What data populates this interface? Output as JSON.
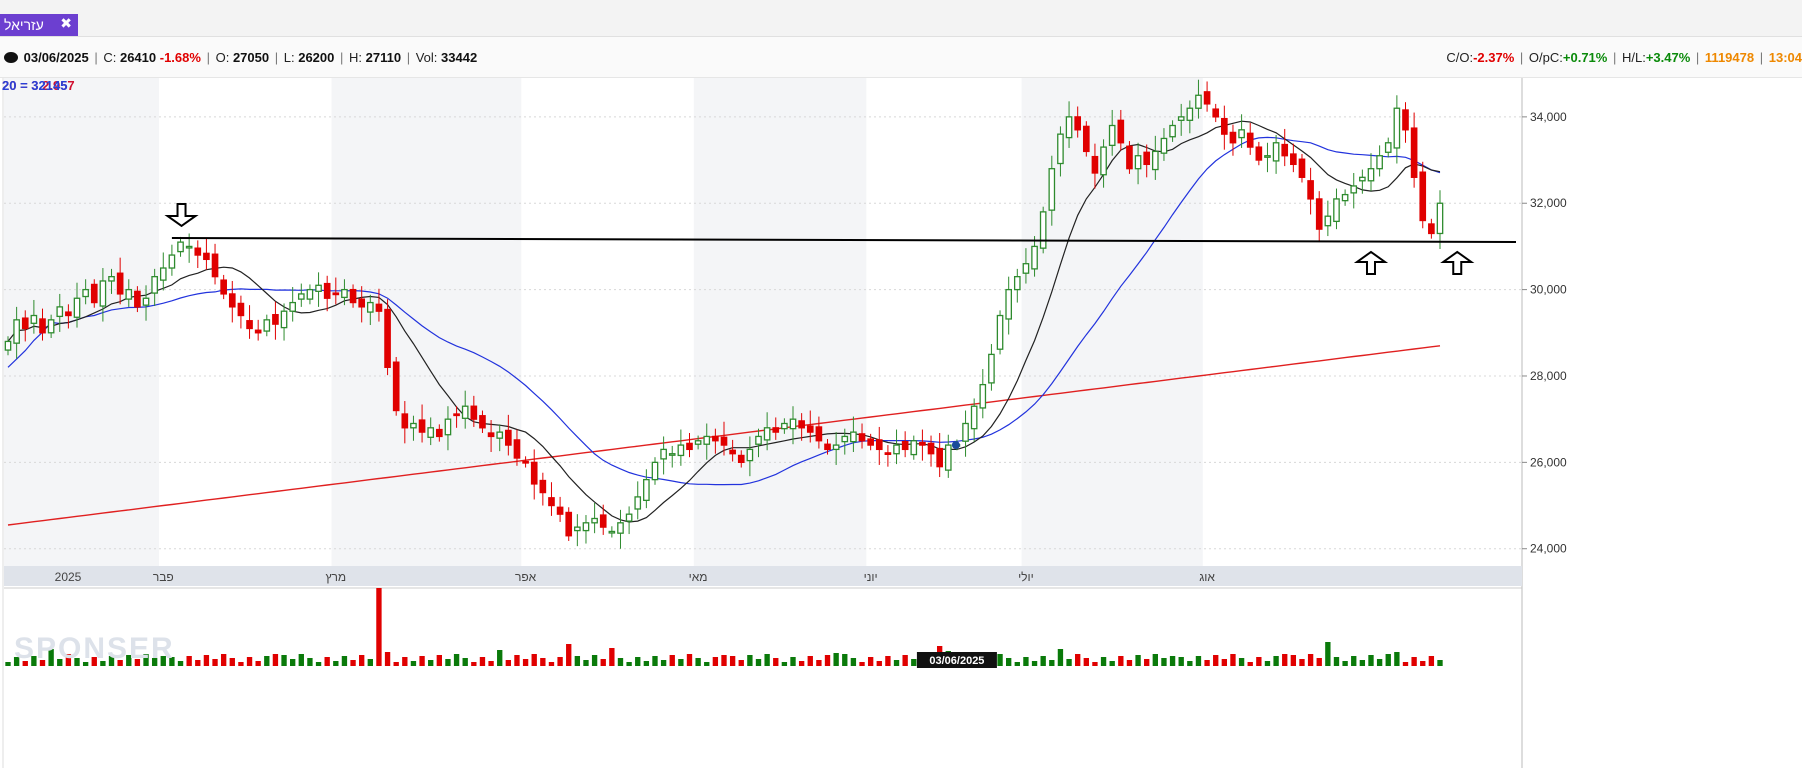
{
  "tab": {
    "label": "עזריאל",
    "close": "✖"
  },
  "infobar": {
    "date": "03/06/2025",
    "close_label": "C:",
    "close_value": "26410",
    "change_pct": "-1.68%",
    "open_label": "O:",
    "open_value": "27050",
    "low_label": "L:",
    "low_value": "26200",
    "high_label": "H:",
    "high_value": "27110",
    "vol_label": "Vol:",
    "vol_value": "33442",
    "co_label": "C/O:",
    "co_value": "-2.37%",
    "opc_label": "O/pC:",
    "opc_value": "+0.71%",
    "hl_label": "H/L:",
    "hl_value": "+3.47%",
    "count": "1119478",
    "time": "13:04"
  },
  "overlay": {
    "red_text": "20 = 3 2.957",
    "blue_text": "20 = 32145"
  },
  "watermark": "SPONSER",
  "colors": {
    "up": "#2e8b2e",
    "down": "#e00000",
    "ma_short": "#222222",
    "ma_mid": "#2233dd",
    "ma_long": "#e02020",
    "accent": "#6c3fd0"
  },
  "chart_data": {
    "type": "candlestick",
    "ylim": [
      23600,
      34900
    ],
    "y_ticks": [
      "34,000",
      "32,000",
      "30,000",
      "28,000",
      "26,000",
      "24,000"
    ],
    "y_tick_values": [
      34000,
      32000,
      30000,
      28000,
      26000,
      24000
    ],
    "month_labels": [
      "2025",
      "פבר",
      "מרץ",
      "אפר",
      "מאי",
      "יוני",
      "יולי",
      "אוג"
    ],
    "month_start_index": [
      0,
      18,
      38,
      60,
      80,
      100,
      118,
      139
    ],
    "crosshair_date": "03/06/2025",
    "crosshair_index": 110,
    "support_level": 31150,
    "arrow_down_index": 20,
    "arrow_up_indices": [
      158,
      168
    ],
    "closes": [
      28800,
      29300,
      29100,
      29400,
      29000,
      29300,
      29600,
      29400,
      29800,
      30000,
      29700,
      30200,
      30300,
      29900,
      30000,
      29600,
      29800,
      30300,
      30500,
      30800,
      31100,
      31000,
      30800,
      30700,
      30300,
      29900,
      29600,
      29400,
      29100,
      29000,
      29300,
      29200,
      29500,
      29700,
      29900,
      30000,
      30100,
      29800,
      29900,
      30000,
      29700,
      29600,
      29700,
      29500,
      28200,
      27200,
      26800,
      26900,
      26700,
      26800,
      26600,
      27000,
      27100,
      27300,
      27000,
      26800,
      26600,
      26700,
      26400,
      26100,
      26000,
      25500,
      25300,
      25000,
      24800,
      24300,
      24500,
      24600,
      24700,
      24500,
      24400,
      24600,
      24800,
      25200,
      25600,
      26000,
      26300,
      26200,
      26400,
      26300,
      26500,
      26600,
      26500,
      26400,
      26200,
      26000,
      26300,
      26600,
      26800,
      26700,
      26900,
      27000,
      26800,
      26700,
      26500,
      26300,
      26400,
      26600,
      26700,
      26500,
      26400,
      26300,
      26200,
      26400,
      26300,
      26500,
      26400,
      26200,
      25900,
      26400,
      26410,
      26900,
      27300,
      27800,
      28500,
      29400,
      30000,
      30300,
      30600,
      31000,
      31800,
      32800,
      33600,
      34000,
      33700,
      33200,
      32700,
      33300,
      33800,
      33400,
      32800,
      33100,
      32900,
      33200,
      33500,
      33800,
      34000,
      34200,
      34500,
      34300,
      34000,
      33600,
      33400,
      33700,
      33300,
      33000,
      33100,
      33400,
      33100,
      32900,
      32600,
      32100,
      31400,
      31700,
      32100,
      32200,
      32400,
      32600,
      32800,
      33100,
      33400,
      34200,
      33700,
      32600,
      31600,
      31300,
      32000
    ]
  }
}
